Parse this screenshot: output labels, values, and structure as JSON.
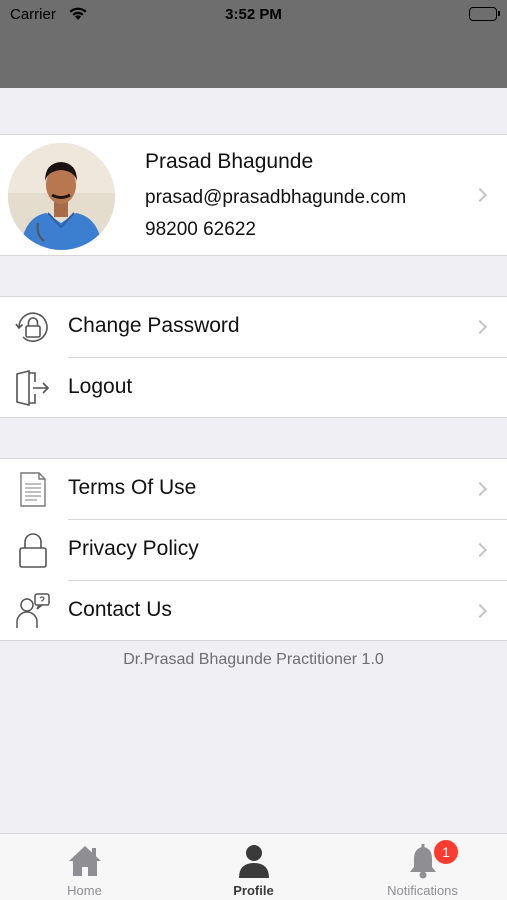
{
  "status_bar": {
    "carrier": "Carrier",
    "time": "3:52 PM"
  },
  "profile": {
    "name": "Prasad Bhagunde",
    "email": "prasad@prasadbhagunde.com",
    "phone": "98200 62622"
  },
  "account_menu": [
    {
      "label": "Change Password",
      "icon": "lock-refresh-icon",
      "chevron": true
    },
    {
      "label": "Logout",
      "icon": "logout-door-icon",
      "chevron": false
    }
  ],
  "info_menu": [
    {
      "label": "Terms Of Use",
      "icon": "document-icon",
      "chevron": true
    },
    {
      "label": "Privacy Policy",
      "icon": "padlock-icon",
      "chevron": true
    },
    {
      "label": "Contact Us",
      "icon": "contact-support-icon",
      "chevron": true
    }
  ],
  "version_text": "Dr.Prasad Bhagunde Practitioner 1.0",
  "tab_bar": {
    "tabs": [
      {
        "label": "Home",
        "icon": "home-icon",
        "active": false
      },
      {
        "label": "Profile",
        "icon": "person-icon",
        "active": true
      },
      {
        "label": "Notifications",
        "icon": "bell-icon",
        "active": false,
        "badge": "1"
      }
    ]
  },
  "colors": {
    "badge": "#ff3b30",
    "header": "#6e6e6e",
    "background": "#efeff4"
  }
}
